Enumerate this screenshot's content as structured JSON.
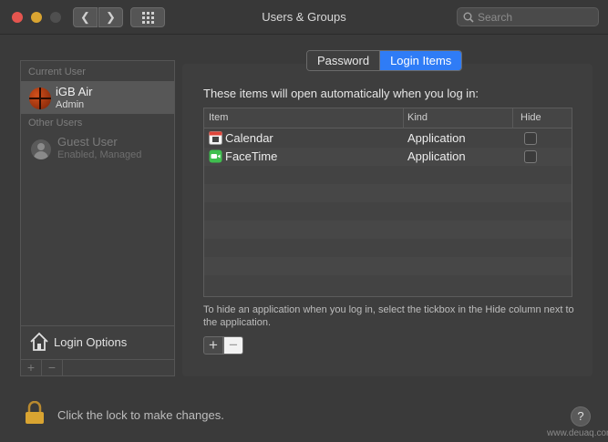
{
  "window": {
    "title": "Users & Groups"
  },
  "search": {
    "placeholder": "Search"
  },
  "sidebar": {
    "current_user_header": "Current User",
    "current_user": {
      "name": "iGB Air",
      "role": "Admin"
    },
    "other_users_header": "Other Users",
    "other_users": [
      {
        "name": "Guest User",
        "status": "Enabled, Managed"
      }
    ],
    "login_options_label": "Login Options",
    "add_label": "+",
    "remove_label": "−"
  },
  "tabs": [
    {
      "label": "Password",
      "active": false
    },
    {
      "label": "Login Items",
      "active": true
    }
  ],
  "login_items": {
    "intro": "These items will open automatically when you log in:",
    "columns": {
      "item": "Item",
      "kind": "Kind",
      "hide": "Hide"
    },
    "rows": [
      {
        "item": "Calendar",
        "kind": "Application",
        "hide": false,
        "icon": "calendar-icon"
      },
      {
        "item": "FaceTime",
        "kind": "Application",
        "hide": false,
        "icon": "facetime-icon"
      }
    ],
    "hint": "To hide an application when you log in, select the tickbox in the Hide column next to the application.",
    "add_label": "+",
    "remove_label": "−"
  },
  "footer": {
    "lock_text": "Click the lock to make changes.",
    "help_label": "?"
  },
  "watermark": "www.deuaq.com",
  "colors": {
    "accent": "#2f7cf6",
    "close": "#e5554f",
    "minimize": "#d9a431"
  }
}
